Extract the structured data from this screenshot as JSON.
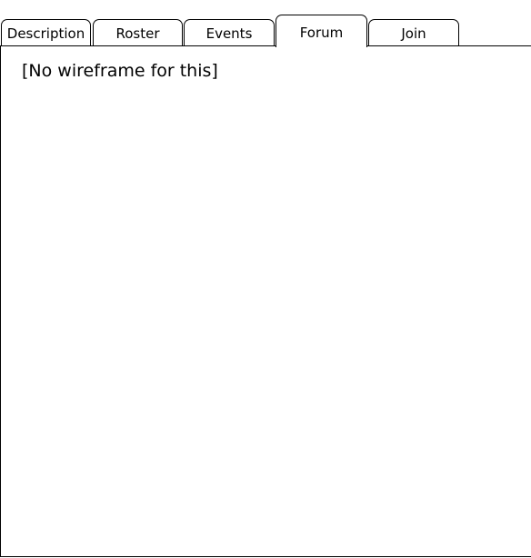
{
  "tabs": [
    {
      "label": "Description",
      "active": false
    },
    {
      "label": "Roster",
      "active": false
    },
    {
      "label": "Events",
      "active": false
    },
    {
      "label": "Forum",
      "active": true
    },
    {
      "label": "Join",
      "active": false
    }
  ],
  "panel": {
    "text": "[No wireframe for this]"
  }
}
